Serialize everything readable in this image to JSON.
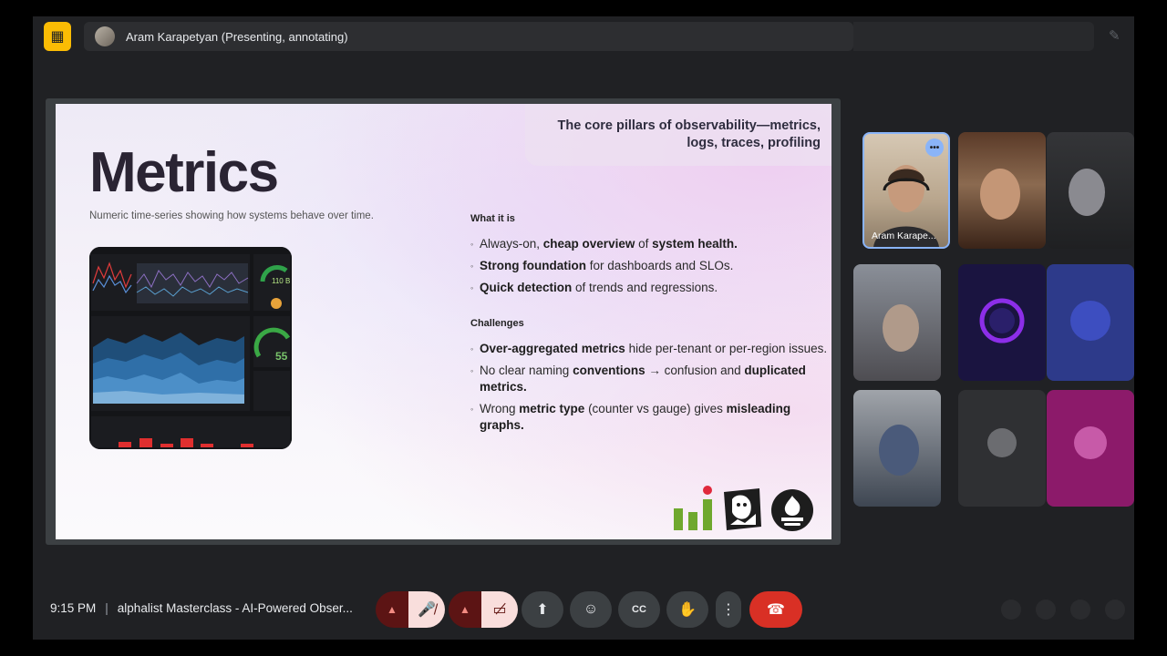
{
  "presenter": {
    "badge_icon": "presentation-off-icon",
    "name": "Aram Karapetyan (Presenting, annotating)"
  },
  "slide": {
    "title": "Metrics",
    "caption": "Numeric time-series showing how systems behave over time.",
    "subtitle_line1": "The core pillars of observability—metrics,",
    "subtitle_line2": "logs, traces, profiling",
    "what_it_is": {
      "heading": "What it is",
      "items": [
        {
          "pre": "Always-on, ",
          "b1": "cheap overview",
          "mid": " of ",
          "b2": "system health.",
          "post": ""
        },
        {
          "pre": "",
          "b1": "Strong foundation",
          "mid": " for dashboards and SLOs.",
          "b2": "",
          "post": ""
        },
        {
          "pre": "",
          "b1": "Quick detection",
          "mid": " of trends and regressions.",
          "b2": "",
          "post": ""
        }
      ]
    },
    "challenges": {
      "heading": "Challenges",
      "items": [
        {
          "pre": "",
          "b1": "Over-aggregated metrics",
          "mid": " hide per-tenant or per-region issues.",
          "b2": "",
          "post": ""
        },
        {
          "pre": "No clear naming ",
          "b1": "conventions",
          "mid": " → confusion and ",
          "b2": "duplicated metrics.",
          "post": ""
        },
        {
          "pre": "Wrong ",
          "b1": "metric type",
          "mid": " (counter vs gauge) gives ",
          "b2": "misleading graphs.",
          "post": ""
        }
      ]
    },
    "dashboard": {
      "gauge_value_1": "110 B",
      "gauge_value_2": "55"
    },
    "logos": [
      "graphite-logo",
      "datadog-logo",
      "prometheus-logo"
    ]
  },
  "participants": [
    {
      "name": "Aram Karape...",
      "speaking": true,
      "bg": "#c9b9a4"
    },
    {
      "name": "",
      "bg": "#7a5a45"
    },
    {
      "name": "",
      "bg": "#2c2d30"
    },
    {
      "name": "",
      "bg": "#6b6a70"
    },
    {
      "name": "",
      "bg": "#1a1440"
    },
    {
      "name": "",
      "bg": "#2d3a8a"
    },
    {
      "name": "",
      "bg": "#8b8f98"
    },
    {
      "name": "",
      "bg": "#2f3033"
    },
    {
      "name": "",
      "bg": "#8c1a6a"
    }
  ],
  "meeting": {
    "time": "9:15 PM",
    "title": "alphalist Masterclass - AI-Powered Obser..."
  },
  "controls": {
    "mic": "mic-off-icon",
    "camera": "camera-off-icon",
    "present": "present-screen-icon",
    "reactions": "emoji-icon",
    "captions": "captions-icon",
    "hand": "raise-hand-icon",
    "more": "more-vert-icon",
    "leave": "end-call-icon"
  },
  "colors": {
    "accent": "#8ab4f8",
    "presenter_badge": "#fbbc04",
    "end_call": "#d93025",
    "muted_bg": "#f9dedc"
  }
}
